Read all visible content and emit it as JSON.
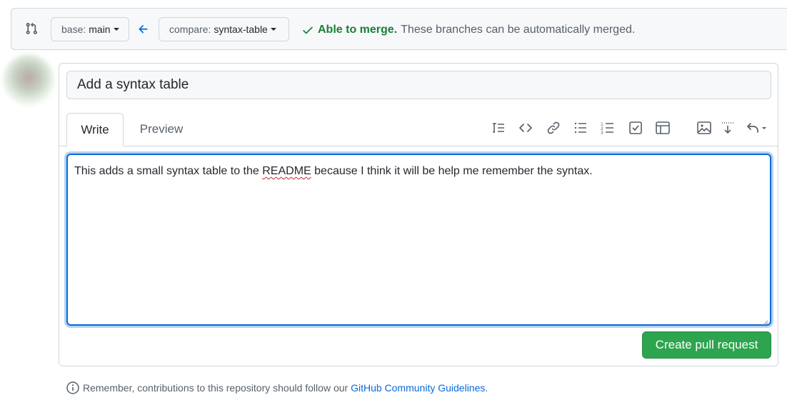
{
  "compare_bar": {
    "base_prefix": "base:",
    "base_value": "main",
    "compare_prefix": "compare:",
    "compare_value": "syntax-table",
    "merge_status": "Able to merge.",
    "merge_description": "These branches can be automatically merged."
  },
  "form": {
    "title_value": "Add a syntax table",
    "tabs": [
      {
        "label": "Write",
        "active": true
      },
      {
        "label": "Preview",
        "active": false
      }
    ],
    "toolbar_icons": [
      "heading-icon",
      "code-icon",
      "link-icon",
      "unordered-list-icon",
      "ordered-list-icon",
      "task-list-icon",
      "table-icon",
      "image-icon",
      "saved-replies-icon",
      "undo-icon"
    ],
    "body_before": "This adds a small syntax table to the ",
    "body_misspelled": "README",
    "body_after": " because I think it will be help me remember the syntax.",
    "submit_label": "Create pull request"
  },
  "footer": {
    "note_text": "Remember, contributions to this repository should follow our ",
    "link_text": "GitHub Community Guidelines",
    "note_end": "."
  },
  "colors": {
    "accent_blue": "#0969da",
    "success_green": "#1a7f37",
    "button_green": "#2da44e"
  }
}
